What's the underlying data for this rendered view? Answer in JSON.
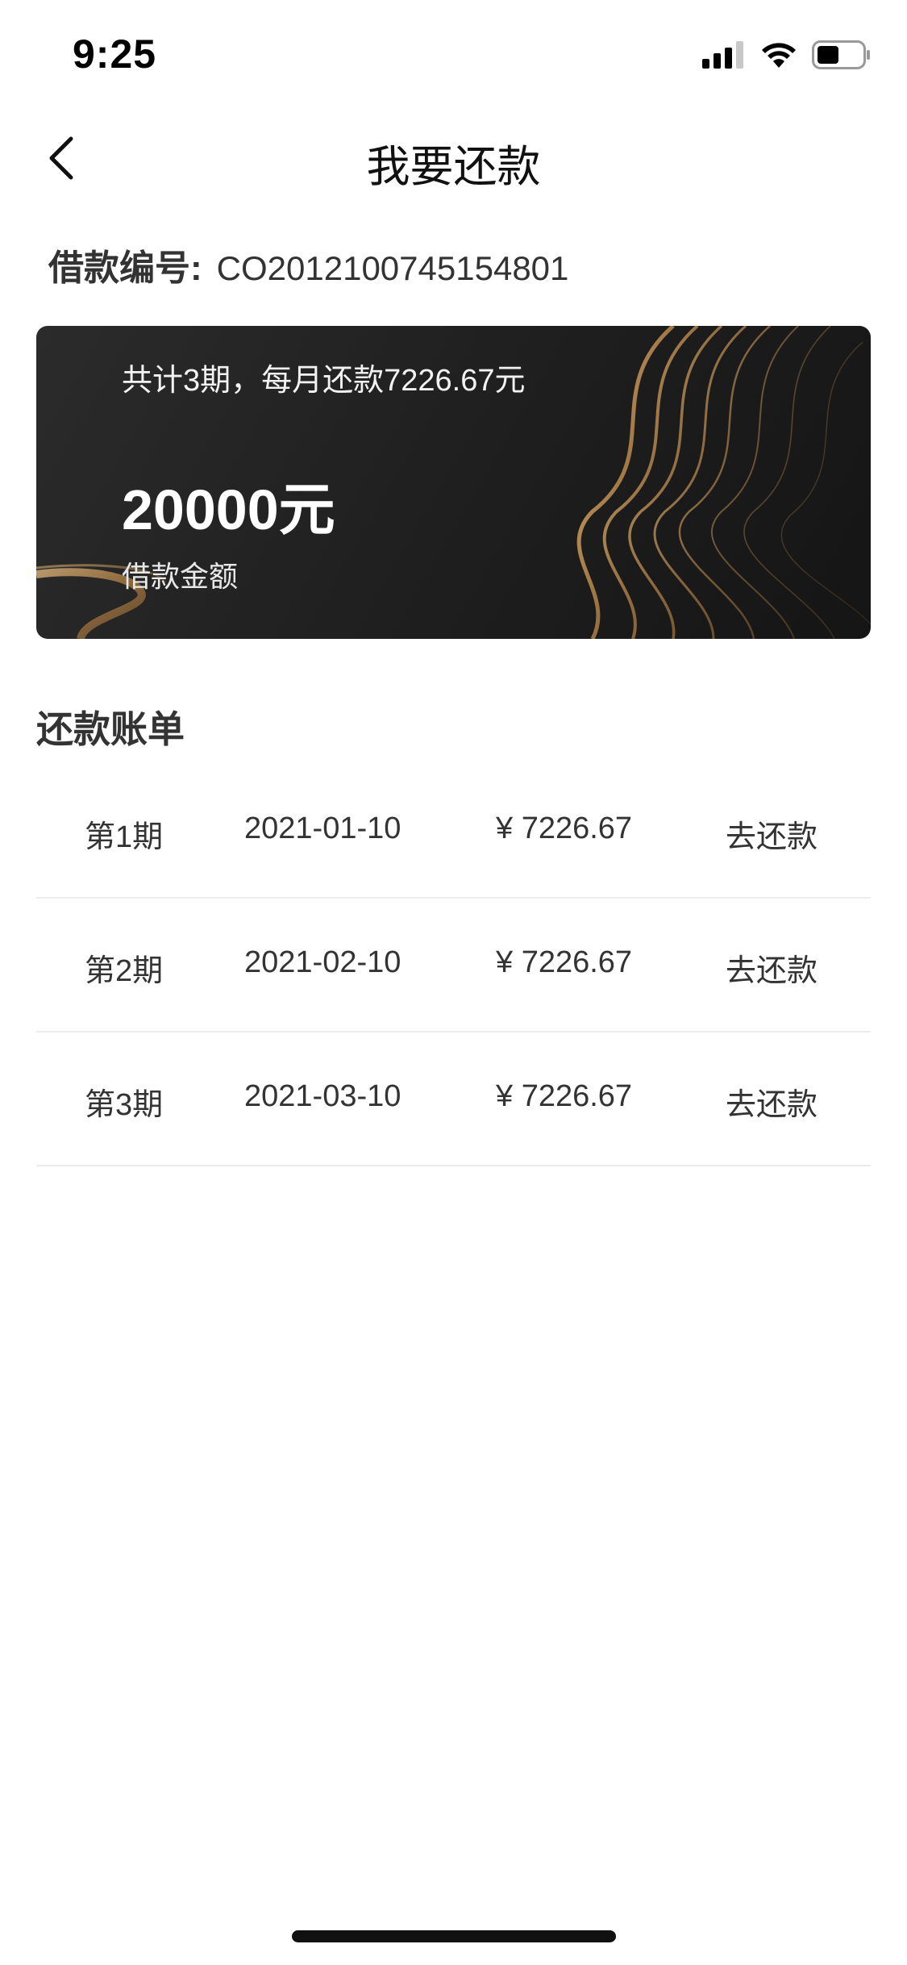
{
  "status_bar": {
    "time": "9:25",
    "icons": [
      "cellular-signal-icon",
      "wifi-icon",
      "battery-icon"
    ]
  },
  "nav": {
    "title": "我要还款",
    "back_icon": "chevron-left-icon"
  },
  "loan": {
    "number_label": "借款编号:",
    "number_value": "CO2012100745154801"
  },
  "card": {
    "summary": "共计3期，每月还款7226.67元",
    "amount": "20000元",
    "amount_label": "借款金额",
    "colors": {
      "background": "#1e1e1e",
      "accent_gold": "#b08a5a"
    }
  },
  "bill": {
    "title": "还款账单",
    "rows": [
      {
        "period": "第1期",
        "date": "2021-01-10",
        "amount": "¥ 7226.67",
        "action": "去还款"
      },
      {
        "period": "第2期",
        "date": "2021-02-10",
        "amount": "¥ 7226.67",
        "action": "去还款"
      },
      {
        "period": "第3期",
        "date": "2021-03-10",
        "amount": "¥ 7226.67",
        "action": "去还款"
      }
    ]
  }
}
